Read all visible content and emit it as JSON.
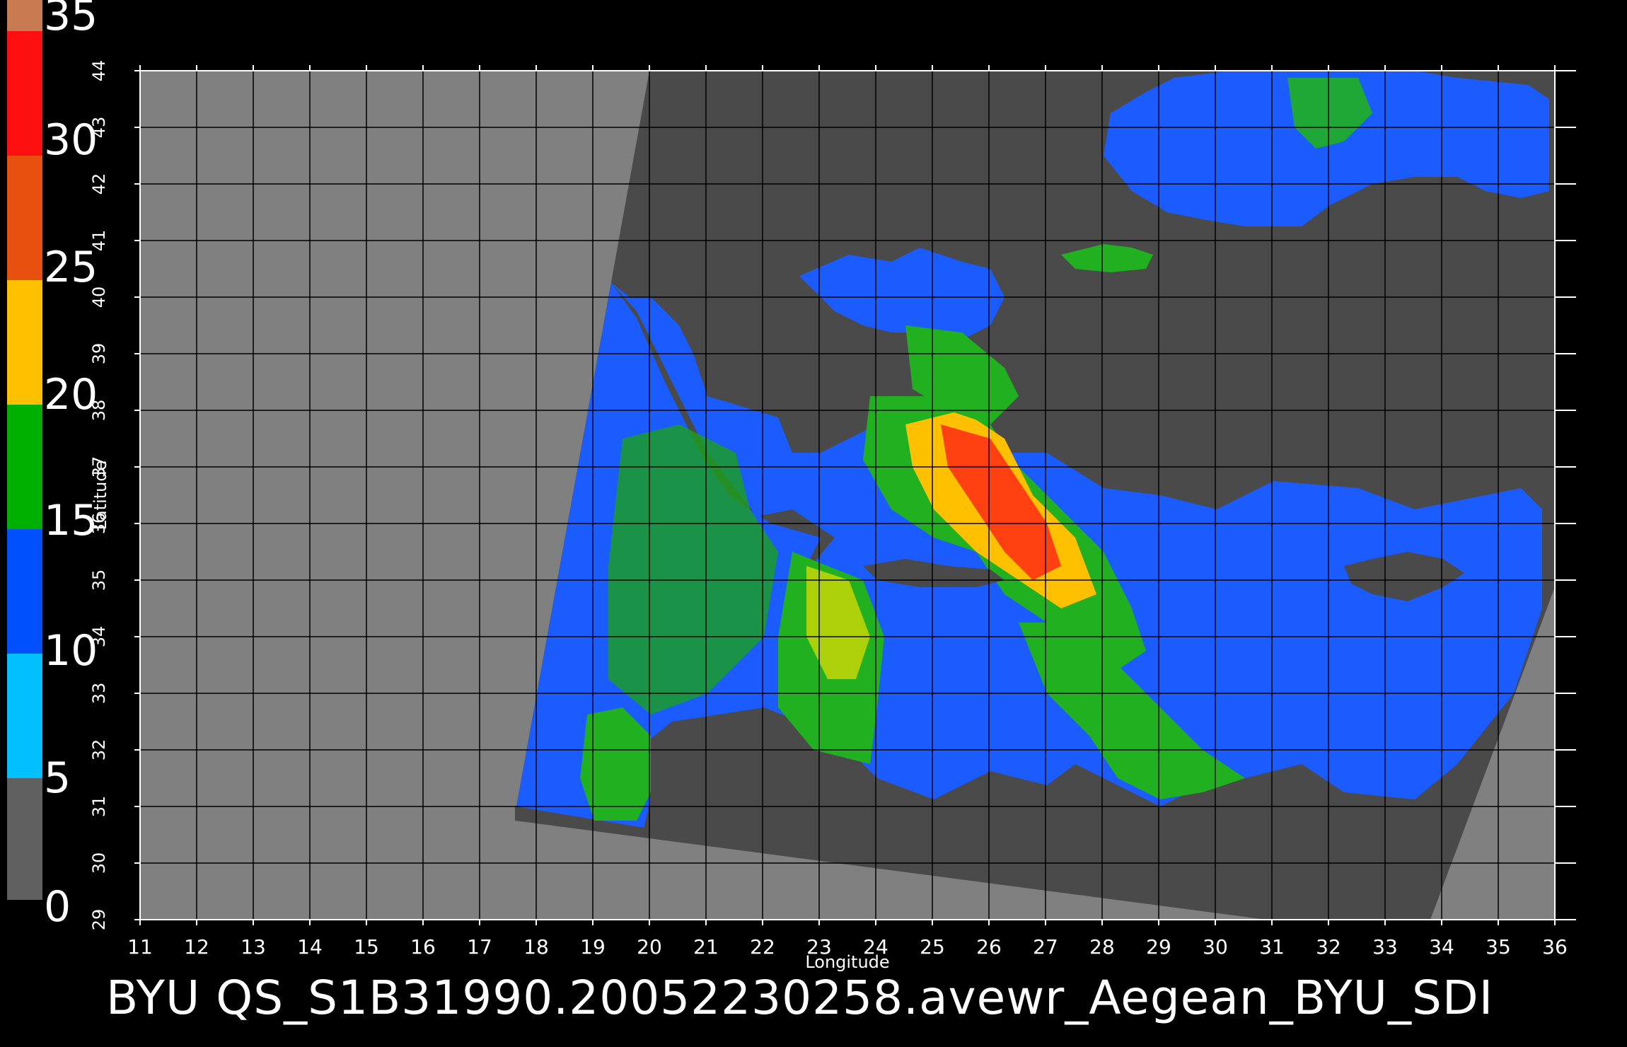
{
  "colorbar": {
    "labels": [
      "35",
      "30",
      "25",
      "20",
      "15",
      "10",
      "5",
      "0"
    ],
    "stops": [
      "#c87a50",
      "#ff1010",
      "#e03010",
      "#ff6000",
      "#ffb000",
      "#ffe000",
      "#ffff40",
      "#00c000",
      "#006000",
      "#0040ff",
      "#0080ff",
      "#00e0ff",
      "#303030",
      "#909090"
    ]
  },
  "axes": {
    "x_ticks": [
      "11",
      "12",
      "13",
      "14",
      "15",
      "16",
      "17",
      "18",
      "19",
      "20",
      "21",
      "22",
      "23",
      "24",
      "25",
      "26",
      "27",
      "28",
      "29",
      "30",
      "31",
      "32",
      "33",
      "34",
      "35",
      "36"
    ],
    "y_ticks": [
      "29",
      "30",
      "31",
      "32",
      "33",
      "34",
      "35",
      "36",
      "37",
      "38",
      "39",
      "40",
      "41",
      "42",
      "43",
      "44"
    ],
    "xlabel": "Longitude",
    "ylabel": "Latitude"
  },
  "caption": "BYU  QS_S1B31990.20052230258.avewr_Aegean_BYU_SDI",
  "colors": {
    "background": "#000000",
    "no_data": "#808080",
    "land": "#4a4a4a",
    "grid": "#000000"
  }
}
